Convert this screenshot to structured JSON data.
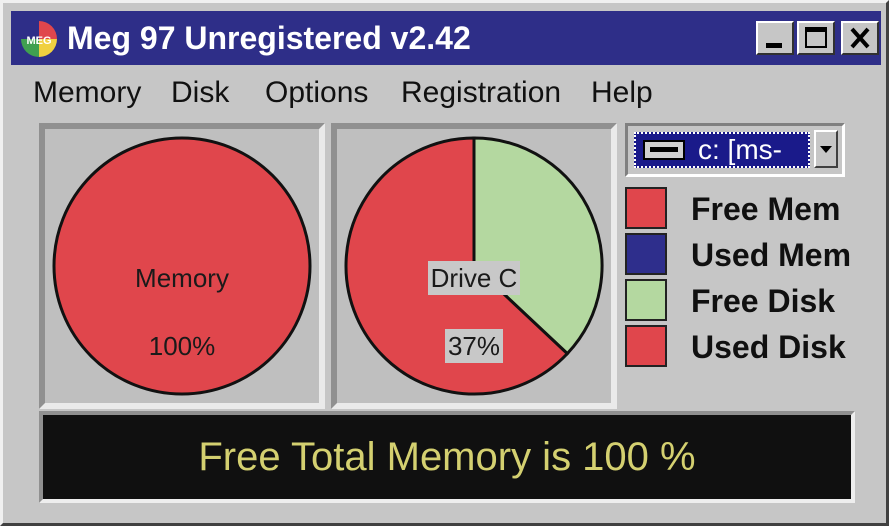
{
  "window": {
    "title": "Meg 97 Unregistered v2.42",
    "app_icon_label": "MEG",
    "controls": {
      "minimize": "minimize-icon",
      "maximize": "maximize-icon",
      "close": "close-icon"
    }
  },
  "menu": {
    "items": [
      {
        "label": "Memory"
      },
      {
        "label": "Disk"
      },
      {
        "label": "Options"
      },
      {
        "label": "Registration"
      },
      {
        "label": "Help"
      }
    ]
  },
  "memory_pie": {
    "label": "Memory",
    "percent_text": "100%"
  },
  "disk_pie": {
    "label": "Drive C",
    "percent_text": "37%"
  },
  "chart_data": [
    {
      "type": "pie",
      "title": "Memory",
      "slices": [
        {
          "name": "Free Mem",
          "value": 100,
          "color": "#e0464c"
        },
        {
          "name": "Used Mem",
          "value": 0,
          "color": "#2e2e8c"
        }
      ]
    },
    {
      "type": "pie",
      "title": "Drive C",
      "slices": [
        {
          "name": "Free Disk",
          "value": 37,
          "color": "#b4d8a0"
        },
        {
          "name": "Used Disk",
          "value": 63,
          "color": "#e0464c"
        }
      ]
    }
  ],
  "drive_select": {
    "value": "c: [ms-",
    "icon": "drive-icon"
  },
  "legend": [
    {
      "label": "Free Mem",
      "color": "#e0464c"
    },
    {
      "label": "Used Mem",
      "color": "#2e2e8c"
    },
    {
      "label": "Free Disk",
      "color": "#b4d8a0"
    },
    {
      "label": "Used Disk",
      "color": "#e0464c"
    }
  ],
  "status": {
    "text": "Free Total Memory is 100 %"
  },
  "colors": {
    "titlebar": "#2e2e88",
    "status_text": "#d4d070",
    "status_bg": "#101010"
  }
}
